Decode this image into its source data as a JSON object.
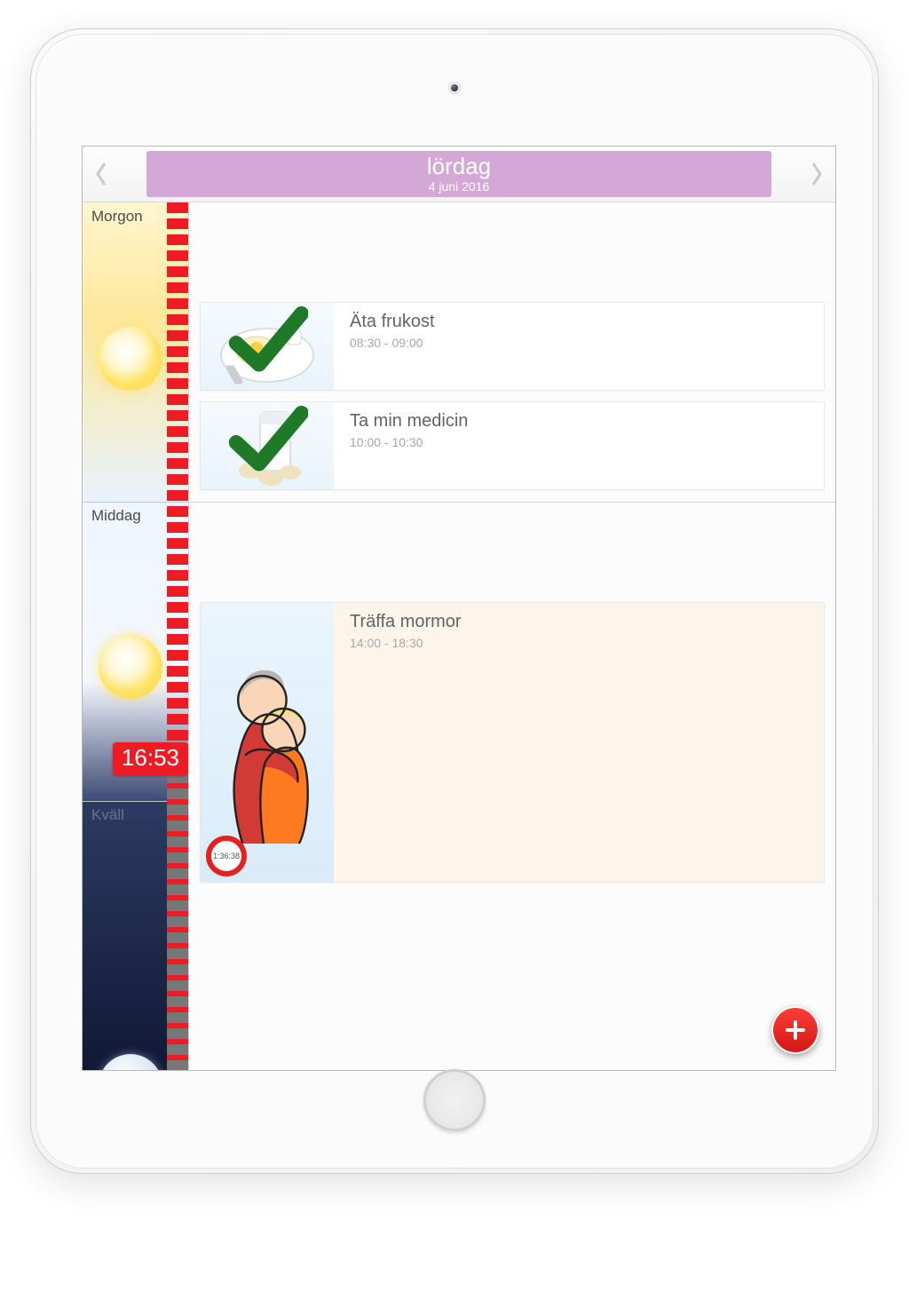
{
  "header": {
    "day": "lördag",
    "date": "4 juni 2016"
  },
  "timeline": {
    "labels": {
      "morning": "Morgon",
      "midday": "Middag",
      "evening": "Kväll"
    },
    "now": "16:53"
  },
  "events": [
    {
      "title": "Äta frukost",
      "time": "08:30 - 09:00",
      "done": true
    },
    {
      "title": "Ta min medicin",
      "time": "10:00 - 10:30",
      "done": true
    },
    {
      "title": "Träffa mormor",
      "time": "14:00 - 18:30",
      "done": false,
      "timer": "1:36:38"
    }
  ]
}
